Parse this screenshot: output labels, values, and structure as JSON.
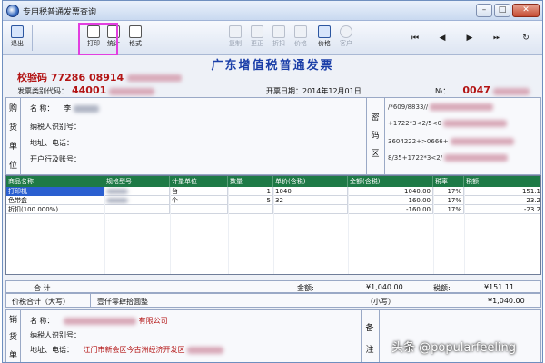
{
  "window": {
    "title": "专用税普通发票查询",
    "buttons": {
      "minimize": "–",
      "maximize": "□",
      "close": "✕"
    }
  },
  "toolbar": {
    "exit": "退出",
    "print": "打印",
    "stats": "统计",
    "format": "格式",
    "copy": "复制",
    "amend": "更正",
    "discount": "折扣",
    "tax_incl": "价格",
    "price_toggle": "价格",
    "customer": "客户",
    "nav": {
      "first": "⏮",
      "prev": "◀",
      "next": "▶",
      "last": "⏭",
      "refresh": "↻"
    }
  },
  "invoice": {
    "title": "广东增值税普通发票",
    "check_code_label": "校验码",
    "check_code": "77286 08914",
    "kind_code_label": "发票类别代码：",
    "kind_code": "44001",
    "date_label": "开票日期：",
    "date": "2014年12月01日",
    "no_label": "№：",
    "no": "0047"
  },
  "buyer": {
    "side": [
      "购",
      "货",
      "单",
      "位"
    ],
    "name_label": "名 称：",
    "name_value": "李",
    "taxid_label": "纳税人识别号：",
    "addr_label": "地址、电话：",
    "bank_label": "开户行及账号：",
    "cipher_side": [
      "密",
      "码",
      "区"
    ],
    "cipher_lines": [
      "/*609/8833//",
      "+1722*3<2/5<0",
      "3604222+>0666+",
      "8/35+1722*3<2/"
    ]
  },
  "grid": {
    "headers": [
      "商品名称",
      "规格型号",
      "计量单位",
      "数量",
      "单价(含税)",
      "金额(含税)",
      "税率",
      "税额"
    ],
    "rows": [
      {
        "name": "打印机",
        "spec": "",
        "unit": "台",
        "qty": "1",
        "price": "1040",
        "amount": "1040.00",
        "rate": "17%",
        "tax": "151.1"
      },
      {
        "name": "色带盒",
        "spec": "",
        "unit": "个",
        "qty": "5",
        "price": "32",
        "amount": "160.00",
        "rate": "17%",
        "tax": "23.2"
      },
      {
        "name": "折扣(100.000%)",
        "spec": "",
        "unit": "",
        "qty": "",
        "price": "",
        "amount": "-160.00",
        "rate": "17%",
        "tax": "-23.2"
      }
    ]
  },
  "totals": {
    "sum_label": "合 计",
    "amount_label": "金额:",
    "amount": "¥1,040.00",
    "tax_label": "税额:",
    "tax": "¥151.11",
    "capital_label": "价税合计（大写）",
    "capital": "壹仟零肆拾圆整",
    "small_label": "（小写）",
    "small": "¥1,040.00"
  },
  "seller": {
    "side": [
      "销",
      "货",
      "单"
    ],
    "name_label": "名 称：",
    "name_value": "有限公司",
    "taxid_label": "纳税人识别号：",
    "addr_label": "地址、电话：",
    "addr_value": "江门市新会区今古洲经济开发区",
    "remark_side": [
      "备",
      "注"
    ]
  },
  "watermark": "头条 @popularfeeling",
  "colors": {
    "accent": "#1e7a46",
    "title": "#1a3ea8",
    "highlight": "#e23ee0",
    "red": "#b31414"
  }
}
